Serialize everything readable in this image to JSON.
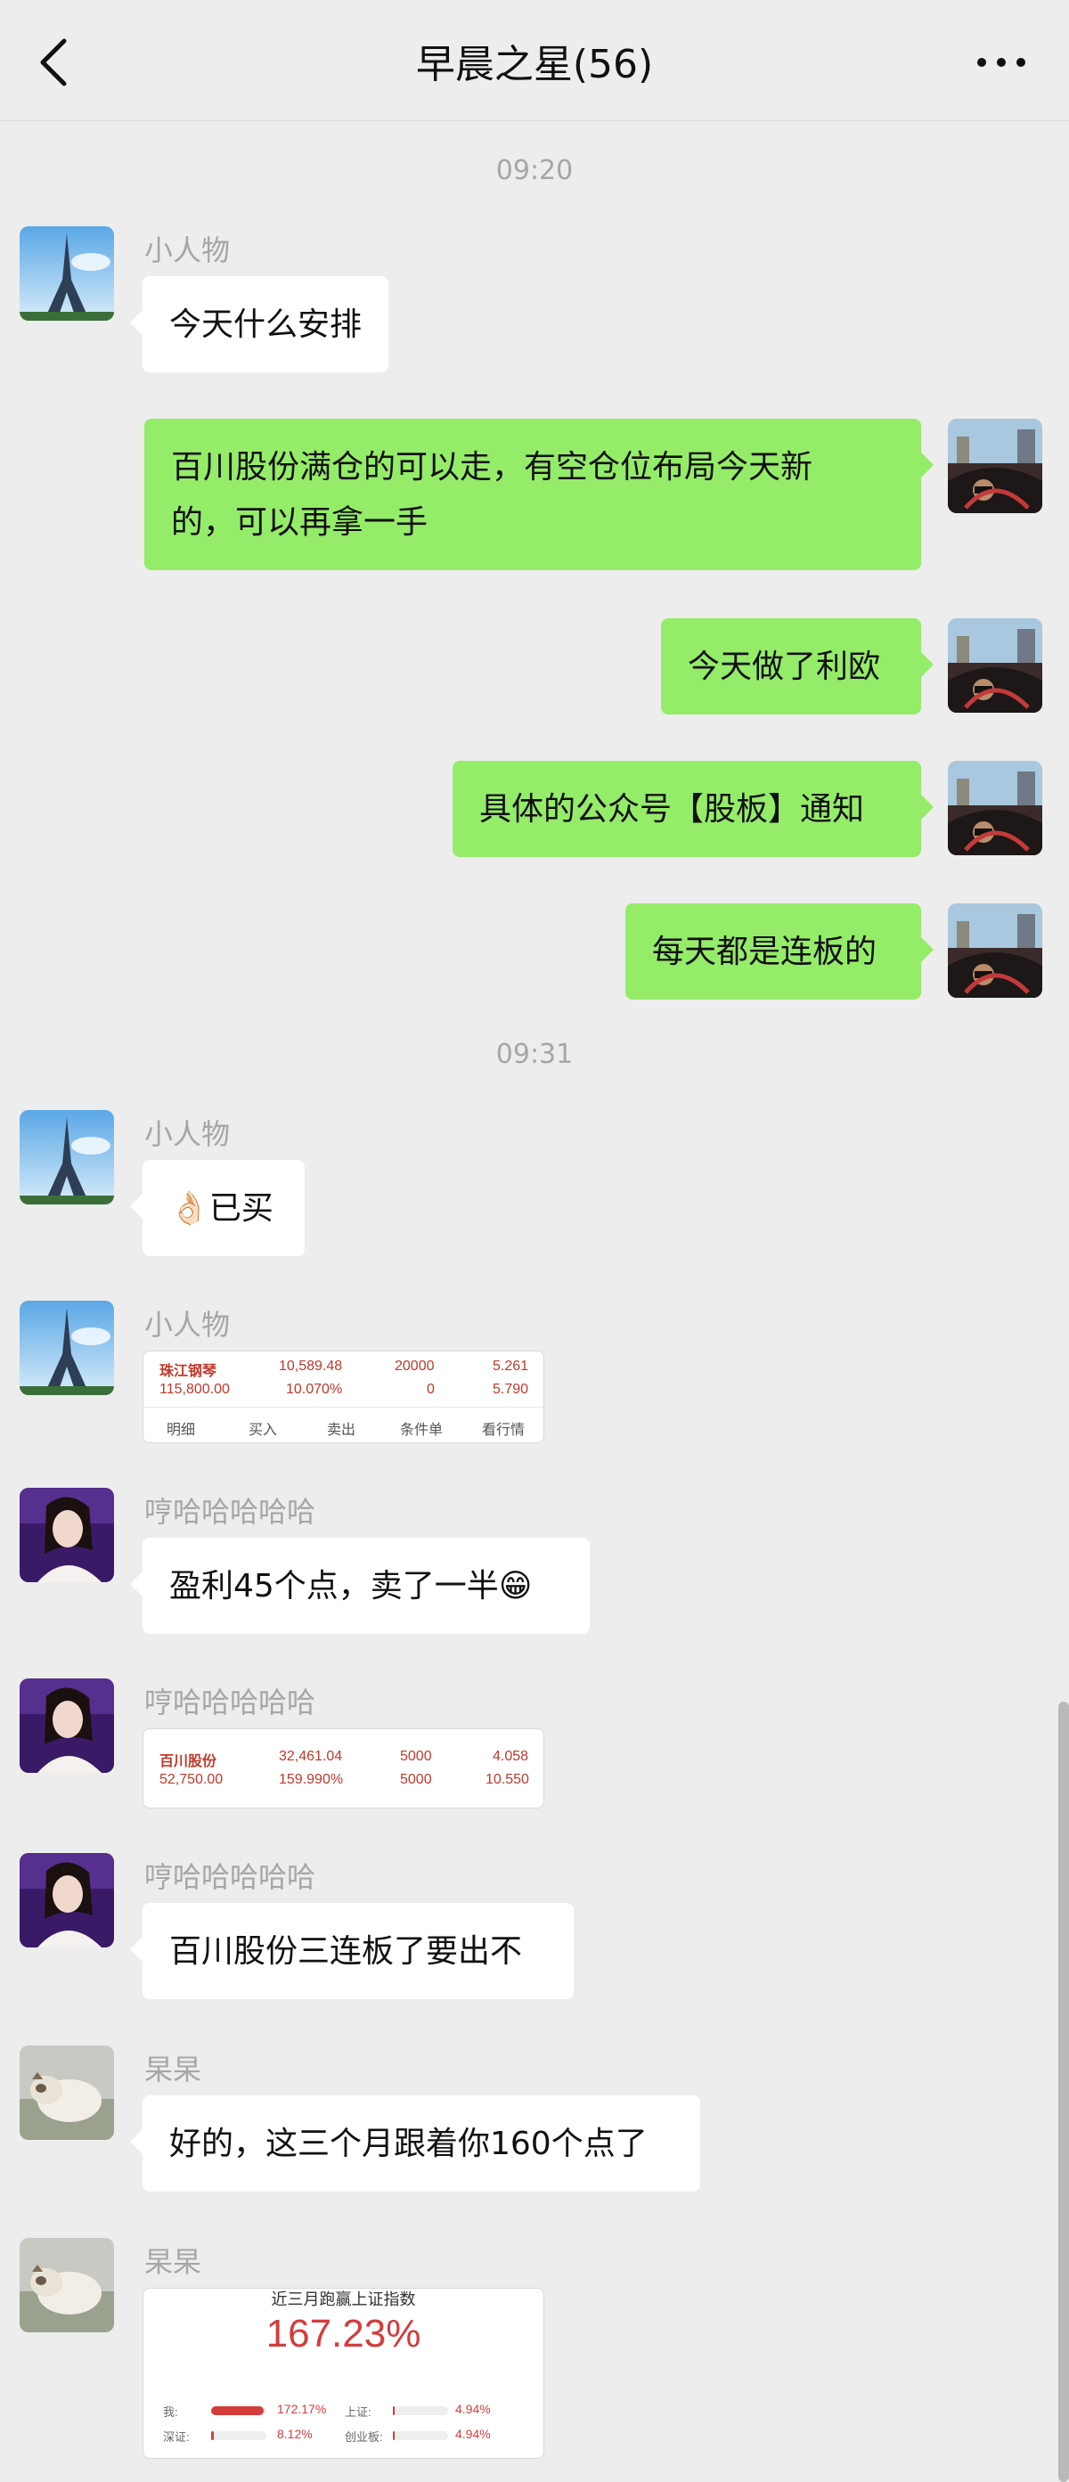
{
  "header": {
    "title": "早晨之星(56)",
    "back_icon": "chevron-left-icon",
    "more_icon": "more-dots-icon"
  },
  "messages": {
    "t1": "09:20",
    "t2": "09:31",
    "m1": {
      "sender": "小人物",
      "text": "今天什么安排"
    },
    "m2": {
      "line1": "百川股份满仓的可以走，有空仓位布局今天新",
      "line2": "的，可以再拿一手"
    },
    "m3": {
      "text": "今天做了利欧"
    },
    "m4": {
      "text": "具体的公众号【股板】通知"
    },
    "m5": {
      "text": "每天都是连板的"
    },
    "m6": {
      "sender": "小人物",
      "emoji": "👌🏻",
      "text": "已买"
    },
    "m7": {
      "sender": "小人物",
      "row1": {
        "name": "珠江钢琴",
        "a": "10,589.48",
        "b": "20000",
        "c": "5.261"
      },
      "row2": {
        "a": "115,800.00",
        "b": "10.070%",
        "c": "0",
        "d": "5.790"
      },
      "tabs": [
        "明细",
        "买入",
        "卖出",
        "条件单",
        "看行情"
      ]
    },
    "m8": {
      "sender": "哼哈哈哈哈哈",
      "text": "盈利45个点，卖了一半",
      "emoji": "😁"
    },
    "m9": {
      "sender": "哼哈哈哈哈哈",
      "row1": {
        "name": "百川股份",
        "a": "32,461.04",
        "b": "5000",
        "c": "4.058"
      },
      "row2": {
        "a": "52,750.00",
        "b": "159.990%",
        "c": "5000",
        "d": "10.550"
      }
    },
    "m10": {
      "sender": "哼哈哈哈哈哈",
      "text": "百川股份三连板了要出不"
    },
    "m11": {
      "sender": "杲杲",
      "text": "好的，这三个月跟着你160个点了"
    },
    "m12": {
      "sender": "杲杲",
      "head": "近三月跑赢上证指数",
      "big": "167.23%",
      "r1": {
        "l1": "我:",
        "v1": "172.17%",
        "l2": "上证:",
        "v2": "4.94%"
      },
      "r2": {
        "l1": "深证:",
        "v1": "8.12%",
        "l2": "创业板:",
        "v2": "4.94%"
      },
      "levels": {
        "me": 0.95,
        "sh": 0.03,
        "sz": 0.05,
        "cy": 0.03
      }
    }
  }
}
